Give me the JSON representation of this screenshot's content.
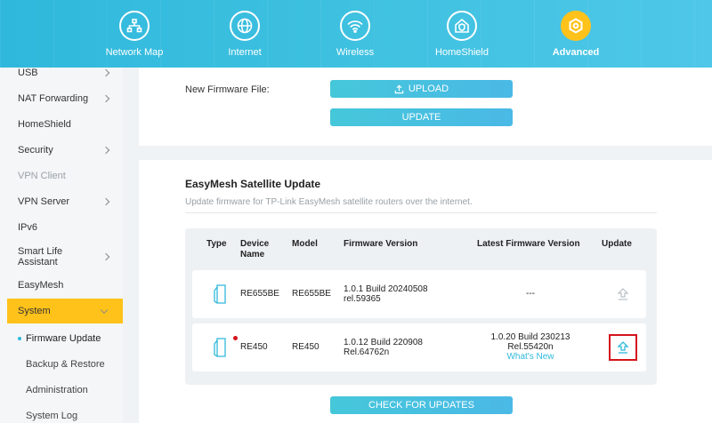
{
  "nav": {
    "items": [
      {
        "label": "Network Map",
        "icon": "network-map-icon"
      },
      {
        "label": "Internet",
        "icon": "globe-icon"
      },
      {
        "label": "Wireless",
        "icon": "wifi-icon"
      },
      {
        "label": "HomeShield",
        "icon": "homeshield-icon"
      },
      {
        "label": "Advanced",
        "icon": "gear-icon",
        "active": true
      }
    ],
    "accent": "#ffc21a",
    "bar_color": "#3fc1e0"
  },
  "sidebar": {
    "items": [
      {
        "label": "USB"
      },
      {
        "label": "NAT Forwarding"
      },
      {
        "label": "HomeShield"
      },
      {
        "label": "Security"
      },
      {
        "label": "VPN Client"
      },
      {
        "label": "VPN Server"
      },
      {
        "label": "IPv6"
      },
      {
        "label": "Smart Life Assistant"
      },
      {
        "label": "EasyMesh"
      },
      {
        "label": "System"
      }
    ],
    "sub_items": [
      {
        "label": "Firmware Update"
      },
      {
        "label": "Backup & Restore"
      },
      {
        "label": "Administration"
      },
      {
        "label": "System Log"
      }
    ]
  },
  "firmware": {
    "file_label": "New Firmware File:",
    "upload_label": "UPLOAD",
    "update_label": "UPDATE"
  },
  "easymesh": {
    "title": "EasyMesh Satellite Update",
    "description": "Update firmware for TP-Link EasyMesh satellite routers over the internet.",
    "columns": [
      "Type",
      "Device Name",
      "Model",
      "Firmware Version",
      "Latest Firmware Version",
      "Update"
    ],
    "rows": [
      {
        "device_name": "RE655BE",
        "model": "RE655BE",
        "fw_line1": "1.0.1 Build 20240508",
        "fw_line2": "rel.59365",
        "latest_line1": "---",
        "latest_line2": "",
        "latest_link": ""
      },
      {
        "device_name": "RE450",
        "model": "RE450",
        "fw_line1": "1.0.12 Build 220908",
        "fw_line2": "Rel.64762n",
        "latest_line1": "1.0.20 Build 230213",
        "latest_line2": "Rel.55420n",
        "latest_link": "What's New"
      }
    ],
    "check_label": "CHECK FOR UPDATES",
    "highlight_color": "#d4141c"
  }
}
